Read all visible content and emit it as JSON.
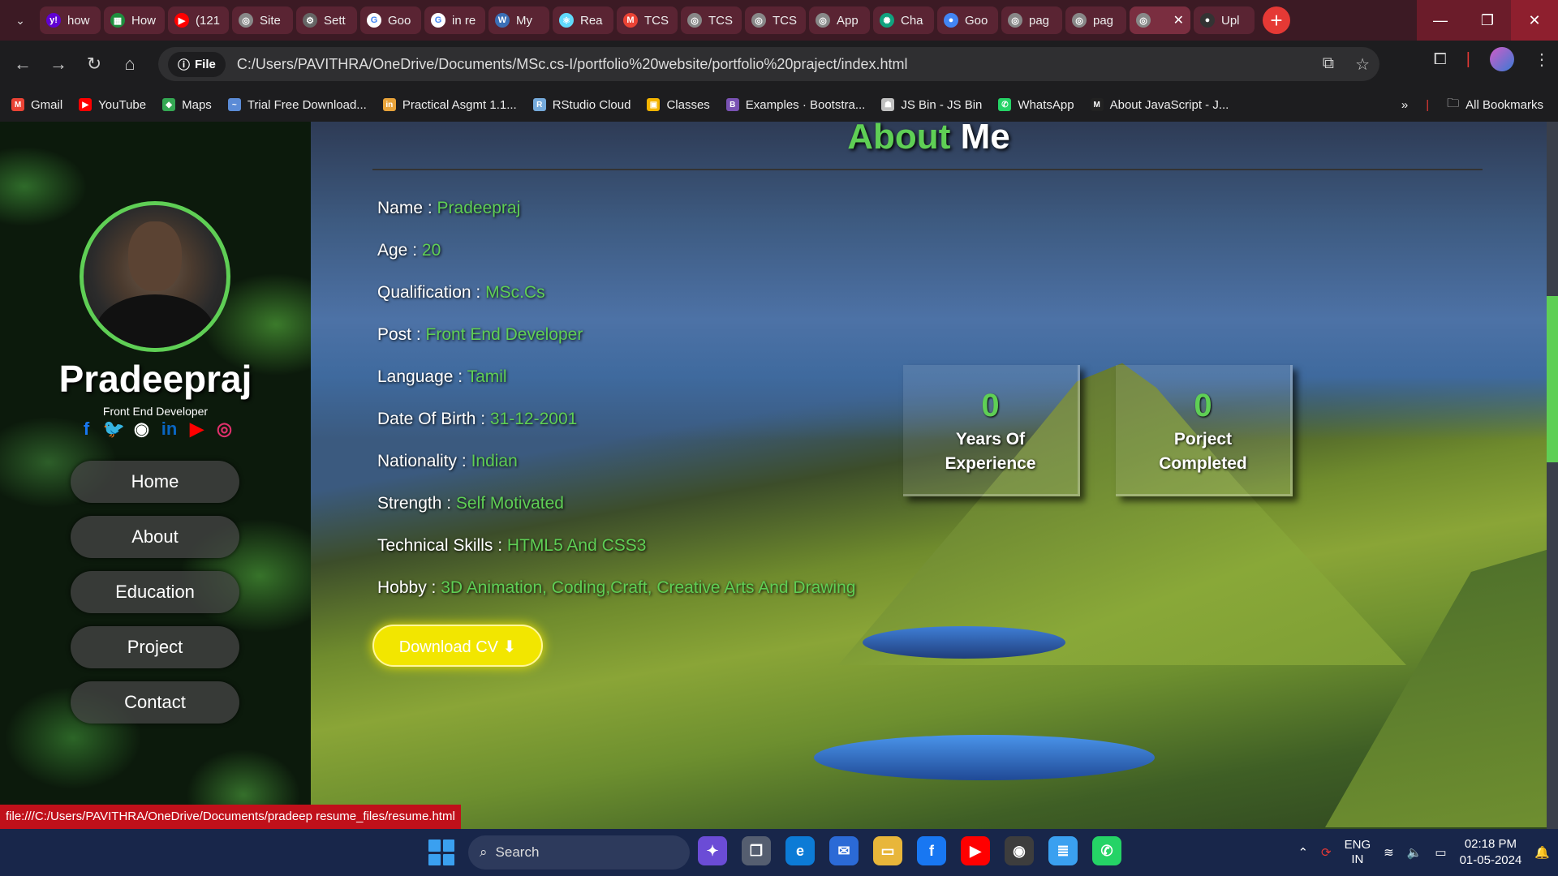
{
  "browser": {
    "tabs": [
      {
        "label": "how",
        "icon": "yahoo-icon",
        "color": "#6001d2",
        "glyph": "y!"
      },
      {
        "label": "How",
        "icon": "sheets-icon",
        "color": "#1e8e3e",
        "glyph": "▦"
      },
      {
        "label": "(121",
        "icon": "youtube-icon",
        "color": "#ff0000",
        "glyph": "▶"
      },
      {
        "label": "Site",
        "icon": "globe-icon",
        "color": "#888888",
        "glyph": "◎"
      },
      {
        "label": "Sett",
        "icon": "gear-icon",
        "color": "#666666",
        "glyph": "⚙"
      },
      {
        "label": "Goo",
        "icon": "google-icon",
        "color": "#ffffff",
        "glyph": "G"
      },
      {
        "label": "in re",
        "icon": "google-icon",
        "color": "#ffffff",
        "glyph": "G"
      },
      {
        "label": "My",
        "icon": "wordpress-icon",
        "color": "#3b6fb6",
        "glyph": "W"
      },
      {
        "label": "Rea",
        "icon": "react-icon",
        "color": "#61dafb",
        "glyph": "⚛"
      },
      {
        "label": "TCS",
        "icon": "gmail-icon",
        "color": "#ea4335",
        "glyph": "M"
      },
      {
        "label": "TCS",
        "icon": "globe-icon",
        "color": "#888888",
        "glyph": "◎"
      },
      {
        "label": "TCS",
        "icon": "globe-icon",
        "color": "#888888",
        "glyph": "◎"
      },
      {
        "label": "App",
        "icon": "globe-icon",
        "color": "#888888",
        "glyph": "◎"
      },
      {
        "label": "Cha",
        "icon": "chatgpt-icon",
        "color": "#10a37f",
        "glyph": "✺"
      },
      {
        "label": "Goo",
        "icon": "gemini-icon",
        "color": "#4285f4",
        "glyph": "●"
      },
      {
        "label": "pag",
        "icon": "globe-icon",
        "color": "#888888",
        "glyph": "◎"
      },
      {
        "label": "pag",
        "icon": "globe-icon",
        "color": "#888888",
        "glyph": "◎"
      },
      {
        "label": "",
        "icon": "globe-icon",
        "color": "#888888",
        "glyph": "◎",
        "active": true
      },
      {
        "label": "Upl",
        "icon": "github-icon",
        "color": "#333333",
        "glyph": "●"
      }
    ],
    "url_chip": "File",
    "url": "C:/Users/PAVITHRA/OneDrive/Documents/MSc.cs-I/portfolio%20website/portfolio%20praject/index.html",
    "bookmarks": [
      {
        "label": "Gmail",
        "icon": "gmail-icon",
        "color": "#ea4335",
        "glyph": "M"
      },
      {
        "label": "YouTube",
        "icon": "youtube-icon",
        "color": "#ff0000",
        "glyph": "▶"
      },
      {
        "label": "Maps",
        "icon": "maps-icon",
        "color": "#34a853",
        "glyph": "◆"
      },
      {
        "label": "Trial Free Download...",
        "icon": "download-icon",
        "color": "#5b8bd6",
        "glyph": "~"
      },
      {
        "label": "Practical Asgmt 1.1...",
        "icon": "practical-icon",
        "color": "#e8a33a",
        "glyph": "in"
      },
      {
        "label": "RStudio Cloud",
        "icon": "rstudio-icon",
        "color": "#75aadb",
        "glyph": "R"
      },
      {
        "label": "Classes",
        "icon": "classroom-icon",
        "color": "#f4b400",
        "glyph": "▣"
      },
      {
        "label": "Examples · Bootstra...",
        "icon": "bootstrap-icon",
        "color": "#7952b3",
        "glyph": "B"
      },
      {
        "label": "JS Bin - JS Bin",
        "icon": "jsbin-icon",
        "color": "#c0c0c0",
        "glyph": "☗"
      },
      {
        "label": "WhatsApp",
        "icon": "whatsapp-icon",
        "color": "#25d366",
        "glyph": "✆"
      },
      {
        "label": "About JavaScript - J...",
        "icon": "mdn-icon",
        "color": "#222222",
        "glyph": "M"
      }
    ],
    "all_bookmarks": "All Bookmarks"
  },
  "sidebar": {
    "name": "Pradeepraj",
    "role": "Front End Developer",
    "socials": [
      {
        "icon": "facebook-icon",
        "glyph": "f",
        "color": "#1877f2"
      },
      {
        "icon": "twitter-icon",
        "glyph": "🐦",
        "color": "#1da1f2"
      },
      {
        "icon": "github-icon",
        "glyph": "◉",
        "color": "#ffffff"
      },
      {
        "icon": "linkedin-icon",
        "glyph": "in",
        "color": "#0a66c2"
      },
      {
        "icon": "youtube-icon",
        "glyph": "▶",
        "color": "#ff0000"
      },
      {
        "icon": "instagram-icon",
        "glyph": "◎",
        "color": "#e1306c"
      }
    ],
    "nav": [
      "Home",
      "About",
      "Education",
      "Project",
      "Contact"
    ]
  },
  "about": {
    "title_a": "About",
    "title_b": "Me",
    "rows": [
      {
        "label": "Name :",
        "value": "Pradeepraj"
      },
      {
        "label": "Age :",
        "value": "20"
      },
      {
        "label": "Qualification :",
        "value": "MSc.Cs"
      },
      {
        "label": "Post :",
        "value": "Front End Developer"
      },
      {
        "label": "Language :",
        "value": "Tamil"
      },
      {
        "label": "Date Of Birth :",
        "value": "31-12-2001"
      },
      {
        "label": "Nationality :",
        "value": "Indian"
      },
      {
        "label": "Strength :",
        "value": "Self Motivated"
      },
      {
        "label": "Technical Skills :",
        "value": "HTML5 And CSS3"
      },
      {
        "label": "Hobby :",
        "value": "3D Animation, Coding,Craft, Creative Arts And Drawing"
      }
    ],
    "download_label": "Download CV",
    "stats": [
      {
        "number": "0",
        "caption_1": "Years Of",
        "caption_2": "Experience"
      },
      {
        "number": "0",
        "caption_1": "Porject",
        "caption_2": "Completed"
      }
    ]
  },
  "status_url": "file:///C:/Users/PAVITHRA/OneDrive/Documents/pradeep resume_files/resume.html",
  "taskbar": {
    "search_label": "Search",
    "apps": [
      {
        "name": "copilot-icon",
        "glyph": "✦",
        "color": "#6b4cd6"
      },
      {
        "name": "taskview-icon",
        "glyph": "❐",
        "color": "#555e70"
      },
      {
        "name": "edge-icon",
        "glyph": "e",
        "color": "#0c7bd6"
      },
      {
        "name": "mail-icon",
        "glyph": "✉",
        "color": "#2b6ad6"
      },
      {
        "name": "explorer-icon",
        "glyph": "▭",
        "color": "#e8b63a"
      },
      {
        "name": "facebook-icon",
        "glyph": "f",
        "color": "#1877f2"
      },
      {
        "name": "youtube-icon",
        "glyph": "▶",
        "color": "#ff0000"
      },
      {
        "name": "chrome-icon",
        "glyph": "◉",
        "color": "#3d3d3d"
      },
      {
        "name": "notepad-icon",
        "glyph": "≣",
        "color": "#3aa0f0"
      },
      {
        "name": "whatsapp-icon",
        "glyph": "✆",
        "color": "#25d366"
      }
    ],
    "lang_1": "ENG",
    "lang_2": "IN",
    "time": "02:18 PM",
    "date": "01-05-2024"
  }
}
